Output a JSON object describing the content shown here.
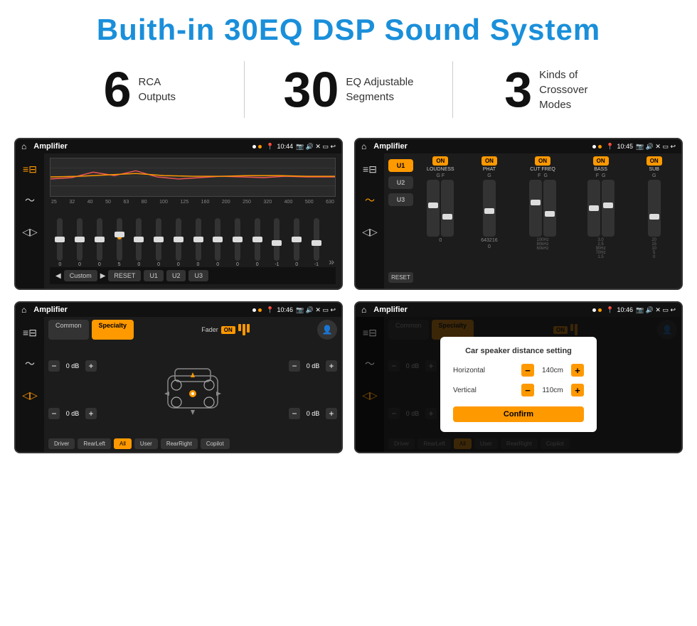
{
  "header": {
    "title": "Buith-in 30EQ DSP Sound System"
  },
  "stats": [
    {
      "number": "6",
      "label_line1": "RCA",
      "label_line2": "Outputs"
    },
    {
      "number": "30",
      "label_line1": "EQ Adjustable",
      "label_line2": "Segments"
    },
    {
      "number": "3",
      "label_line1": "Kinds of",
      "label_line2": "Crossover Modes"
    }
  ],
  "screens": {
    "eq": {
      "app_name": "Amplifier",
      "time": "10:44",
      "freq_labels": [
        "25",
        "32",
        "40",
        "50",
        "63",
        "80",
        "100",
        "125",
        "160",
        "200",
        "250",
        "320",
        "400",
        "500",
        "630"
      ],
      "slider_values": [
        "0",
        "0",
        "0",
        "5",
        "0",
        "0",
        "0",
        "0",
        "0",
        "0",
        "0",
        "-1",
        "0",
        "-1"
      ],
      "buttons": [
        "Custom",
        "RESET",
        "U1",
        "U2",
        "U3"
      ]
    },
    "crossover": {
      "app_name": "Amplifier",
      "time": "10:45",
      "presets": [
        "U1",
        "U2",
        "U3"
      ],
      "controls": [
        "LOUDNESS",
        "PHAT",
        "CUT FREQ",
        "BASS",
        "SUB"
      ],
      "reset_label": "RESET"
    },
    "fader": {
      "app_name": "Amplifier",
      "time": "10:46",
      "tabs": [
        "Common",
        "Specialty"
      ],
      "fader_label": "Fader",
      "on_label": "ON",
      "db_values": [
        "0 dB",
        "0 dB",
        "0 dB",
        "0 dB"
      ],
      "bottom_buttons": [
        "Driver",
        "RearLeft",
        "All",
        "User",
        "RearRight",
        "Copilot"
      ]
    },
    "distance": {
      "app_name": "Amplifier",
      "time": "10:46",
      "tabs": [
        "Common",
        "Specialty"
      ],
      "dialog_title": "Car speaker distance setting",
      "horizontal_label": "Horizontal",
      "horizontal_value": "140cm",
      "vertical_label": "Vertical",
      "vertical_value": "110cm",
      "confirm_label": "Confirm",
      "db_values": [
        "0 dB",
        "0 dB"
      ],
      "bottom_buttons": [
        "Driver",
        "RearLeft",
        "All",
        "User",
        "RearRight",
        "Copilot"
      ]
    }
  }
}
